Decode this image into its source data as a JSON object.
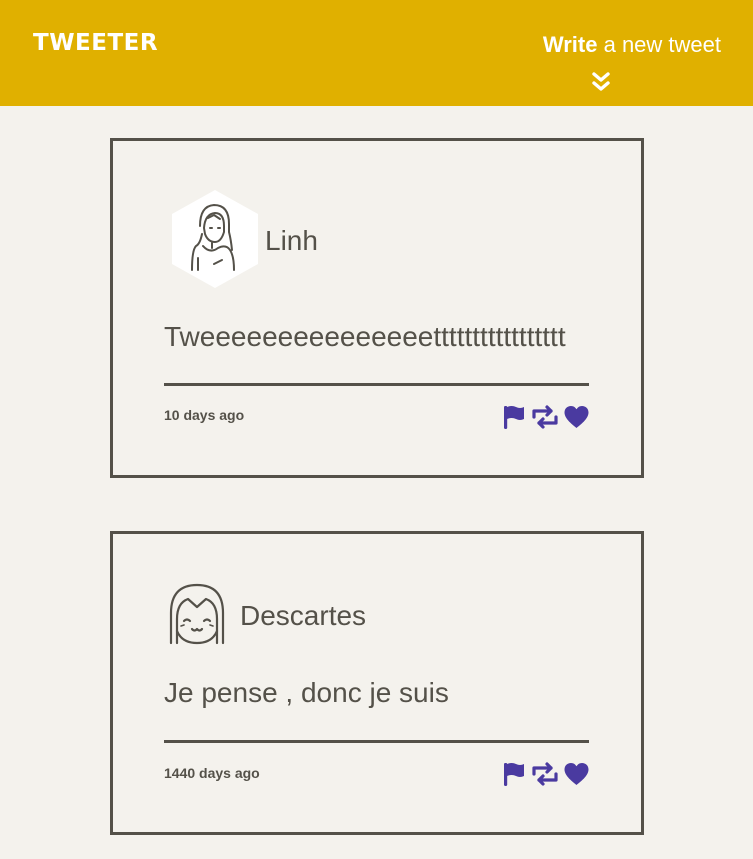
{
  "header": {
    "logo": "TWEETER",
    "compose_strong": "Write",
    "compose_rest": " a new tweet",
    "compose_icon": "double-chevron-down-icon",
    "background": "#e0b000",
    "text_color": "#ffffff"
  },
  "page": {
    "background": "#f4f2ed",
    "text_color": "#545149",
    "action_color": "#4a3aa0"
  },
  "tweets": [
    {
      "author": "Linh",
      "avatar": "woman-avatar-hexagon",
      "content": "Tweeeeeeeeeeeeeeettttttttttttttttt",
      "time": "10 days ago",
      "actions": [
        "flag-icon",
        "retweet-icon",
        "heart-icon"
      ]
    },
    {
      "author": "Descartes",
      "avatar": "girl-avatar-circle",
      "content": "Je pense , donc je suis",
      "time": "1440 days ago",
      "actions": [
        "flag-icon",
        "retweet-icon",
        "heart-icon"
      ]
    }
  ]
}
